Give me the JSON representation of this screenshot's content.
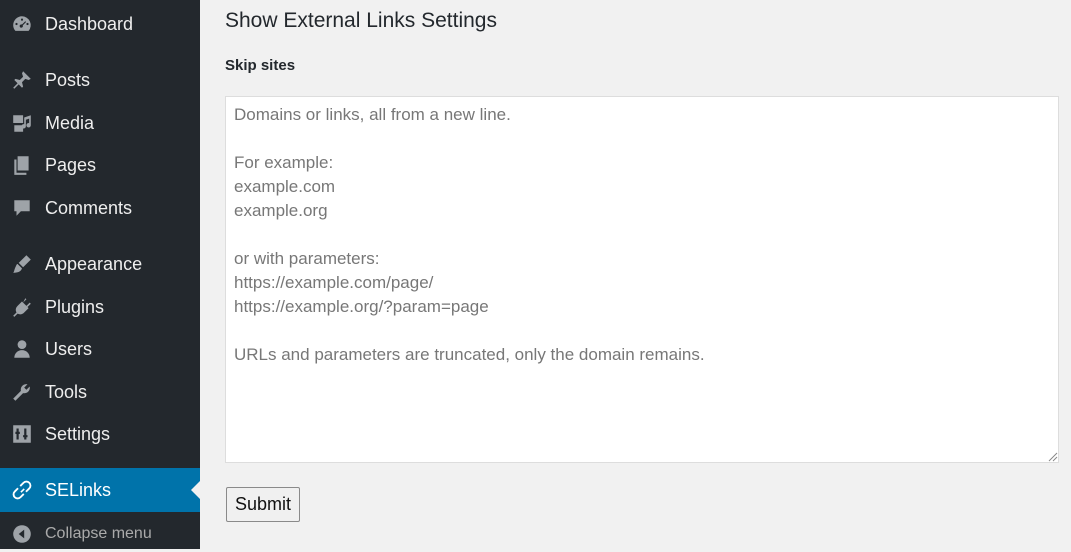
{
  "sidebar": {
    "items": [
      {
        "label": "Dashboard",
        "icon": "dashboard-icon"
      },
      {
        "label": "Posts",
        "icon": "pin-icon"
      },
      {
        "label": "Media",
        "icon": "media-icon"
      },
      {
        "label": "Pages",
        "icon": "pages-icon"
      },
      {
        "label": "Comments",
        "icon": "comment-icon"
      },
      {
        "label": "Appearance",
        "icon": "brush-icon"
      },
      {
        "label": "Plugins",
        "icon": "plug-icon"
      },
      {
        "label": "Users",
        "icon": "user-icon"
      },
      {
        "label": "Tools",
        "icon": "wrench-icon"
      },
      {
        "label": "Settings",
        "icon": "sliders-icon"
      },
      {
        "label": "SELinks",
        "icon": "link-icon",
        "active": true
      }
    ],
    "collapse_label": "Collapse menu",
    "colors": {
      "background": "#23282d",
      "active": "#0073aa",
      "text": "#eeeeee"
    }
  },
  "main": {
    "title": "Show External Links Settings",
    "skip_label": "Skip sites",
    "textarea": {
      "value": "",
      "placeholder": "Domains or links, all from a new line.\n\nFor example:\nexample.com\nexample.org\n\nor with parameters:\nhttps://example.com/page/\nhttps://example.org/?param=page\n\nURLs and parameters are truncated, only the domain remains."
    },
    "submit_label": "Submit"
  }
}
